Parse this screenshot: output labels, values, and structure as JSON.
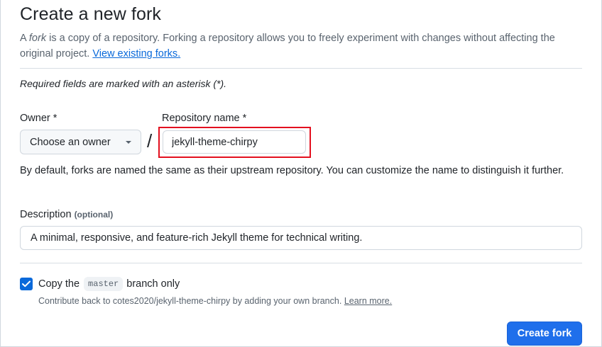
{
  "header": {
    "title": "Create a new fork",
    "intro_word_fork": "fork",
    "intro_prefix": "A ",
    "intro_rest": " is a copy of a repository. Forking a repository allows you to freely experiment with changes without affecting the original project. ",
    "view_forks_link": "View existing forks."
  },
  "form": {
    "required_note": "Required fields are marked with an asterisk (*).",
    "owner": {
      "label": "Owner *",
      "selected": "Choose an owner"
    },
    "separator": "/",
    "repo_name": {
      "label": "Repository name *",
      "value": "jekyll-theme-chirpy"
    },
    "name_help": "By default, forks are named the same as their upstream repository. You can customize the name to distinguish it further.",
    "description": {
      "label": "Description",
      "optional": "(optional)",
      "value": "A minimal, responsive, and feature-rich Jekyll theme for technical writing."
    },
    "copy_branch": {
      "checked": true,
      "label_prefix": "Copy the",
      "branch": "master",
      "label_suffix": "branch only",
      "help_text": "Contribute back to cotes2020/jekyll-theme-chirpy by adding your own branch.",
      "learn_more": "Learn more."
    },
    "submit_label": "Create fork"
  },
  "colors": {
    "primary": "#1f6feb",
    "link": "#0969da",
    "highlight": "#e3101f"
  }
}
